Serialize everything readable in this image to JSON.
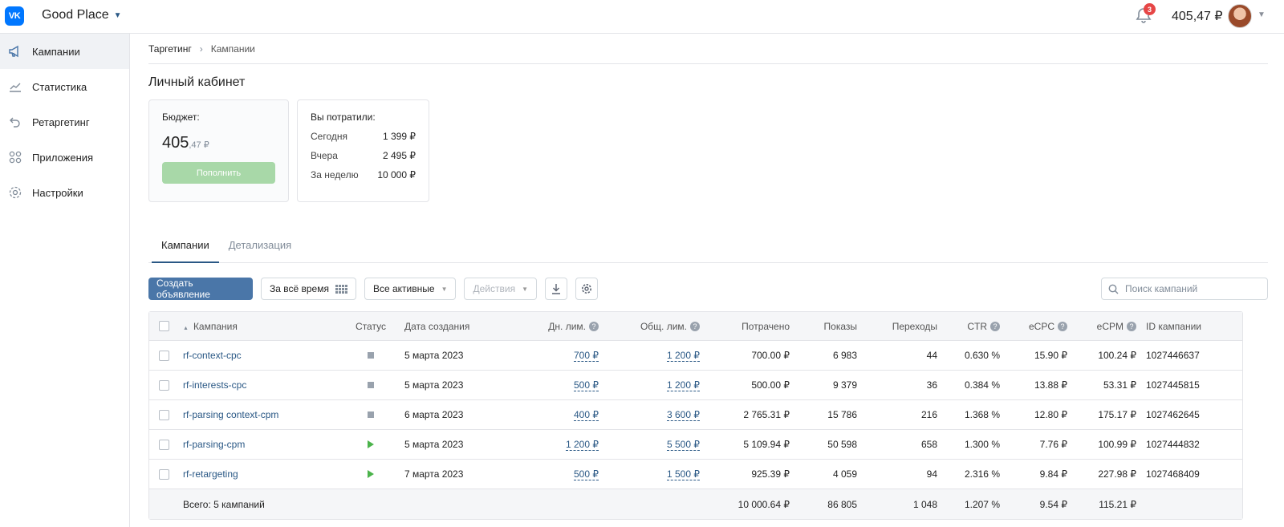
{
  "topbar": {
    "logo": "VK",
    "account_name": "Good Place",
    "notifications_count": "3",
    "balance": "405,47 ₽"
  },
  "sidebar": {
    "items": [
      {
        "label": "Кампании",
        "icon": "megaphone-icon",
        "active": true
      },
      {
        "label": "Статистика",
        "icon": "chart-icon",
        "active": false
      },
      {
        "label": "Ретаргетинг",
        "icon": "retarget-icon",
        "active": false
      },
      {
        "label": "Приложения",
        "icon": "apps-icon",
        "active": false
      },
      {
        "label": "Настройки",
        "icon": "gear-icon",
        "active": false
      }
    ]
  },
  "breadcrumb": {
    "root": "Таргетинг",
    "current": "Кампании"
  },
  "page_title": "Личный кабинет",
  "budget_card": {
    "title": "Бюджет:",
    "amount_int": "405",
    "amount_dec": ",47 ₽",
    "topup_label": "Пополнить"
  },
  "spent_card": {
    "title": "Вы потратили:",
    "rows": [
      {
        "label": "Сегодня",
        "value": "1 399 ₽"
      },
      {
        "label": "Вчера",
        "value": "2 495 ₽"
      },
      {
        "label": "За неделю",
        "value": "10 000 ₽"
      }
    ]
  },
  "tabs": [
    {
      "label": "Кампании",
      "active": true
    },
    {
      "label": "Детализация",
      "active": false
    }
  ],
  "toolbar": {
    "create_label": "Создать объявление",
    "period_label": "За всё время",
    "filter_label": "Все активные",
    "actions_label": "Действия",
    "search_placeholder": "Поиск кампаний"
  },
  "table": {
    "headers": {
      "name": "Кампания",
      "status": "Статус",
      "date": "Дата создания",
      "day_limit": "Дн. лим.",
      "total_limit": "Общ. лим.",
      "spent": "Потрачено",
      "shows": "Показы",
      "clicks": "Переходы",
      "ctr": "CTR",
      "ecpc": "eCPC",
      "ecpm": "eCPM",
      "id": "ID кампании"
    },
    "rows": [
      {
        "name": "rf-context-cpc",
        "status": "stopped",
        "date": "5 марта 2023",
        "day_limit": "700 ₽",
        "total_limit": "1 200 ₽",
        "spent": "700.00 ₽",
        "shows": "6 983",
        "clicks": "44",
        "ctr": "0.630 %",
        "ecpc": "15.90 ₽",
        "ecpm": "100.24 ₽",
        "id": "1027446637"
      },
      {
        "name": "rf-interests-cpc",
        "status": "stopped",
        "date": "5 марта 2023",
        "day_limit": "500 ₽",
        "total_limit": "1 200 ₽",
        "spent": "500.00 ₽",
        "shows": "9 379",
        "clicks": "36",
        "ctr": "0.384 %",
        "ecpc": "13.88 ₽",
        "ecpm": "53.31 ₽",
        "id": "1027445815"
      },
      {
        "name": "rf-parsing context-cpm",
        "status": "stopped",
        "date": "6 марта 2023",
        "day_limit": "400 ₽",
        "total_limit": "3 600 ₽",
        "spent": "2 765.31 ₽",
        "shows": "15 786",
        "clicks": "216",
        "ctr": "1.368 %",
        "ecpc": "12.80 ₽",
        "ecpm": "175.17 ₽",
        "id": "1027462645"
      },
      {
        "name": "rf-parsing-cpm",
        "status": "running",
        "date": "5 марта 2023",
        "day_limit": "1 200 ₽",
        "total_limit": "5 500 ₽",
        "spent": "5 109.94 ₽",
        "shows": "50 598",
        "clicks": "658",
        "ctr": "1.300 %",
        "ecpc": "7.76 ₽",
        "ecpm": "100.99 ₽",
        "id": "1027444832"
      },
      {
        "name": "rf-retargeting",
        "status": "running",
        "date": "7 марта 2023",
        "day_limit": "500 ₽",
        "total_limit": "1 500 ₽",
        "spent": "925.39 ₽",
        "shows": "4 059",
        "clicks": "94",
        "ctr": "2.316 %",
        "ecpc": "9.84 ₽",
        "ecpm": "227.98 ₽",
        "id": "1027468409"
      }
    ],
    "total": {
      "label": "Всего: 5 кампаний",
      "spent": "10 000.64 ₽",
      "shows": "86 805",
      "clicks": "1 048",
      "ctr": "1.207 %",
      "ecpc": "9.54 ₽",
      "ecpm": "115.21 ₽"
    }
  },
  "colors": {
    "accent": "#4a76a8",
    "link": "#2a5885",
    "topup": "#a8d8a8",
    "running": "#4bb34b",
    "stopped": "#99a2ad"
  }
}
